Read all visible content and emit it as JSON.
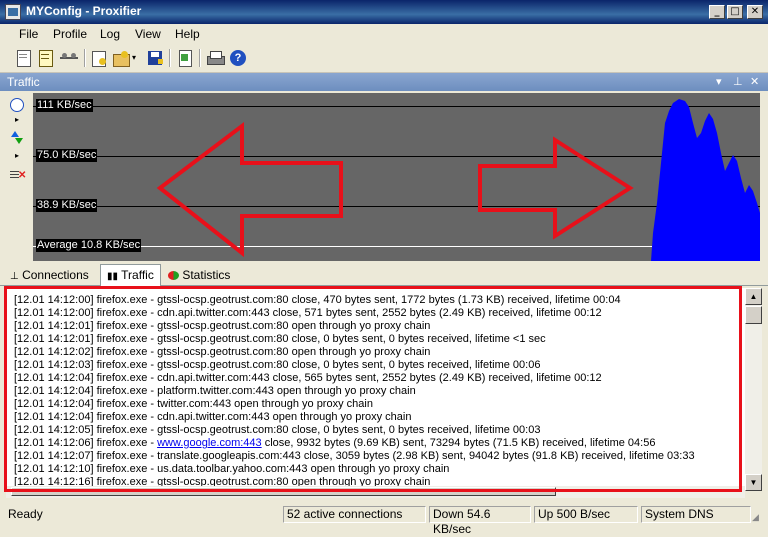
{
  "window": {
    "title": "MYConfig - Proxifier"
  },
  "menu": {
    "items": [
      "File",
      "Profile",
      "Log",
      "View",
      "Help"
    ]
  },
  "toolbar": {
    "icons": [
      "profile-new-icon",
      "profile-edit-icon",
      "network-settings-icon",
      "proxy-add-icon",
      "rules-icon",
      "save-icon",
      "proxy-check-icon",
      "print-icon",
      "help-icon"
    ]
  },
  "panel": {
    "title": "Traffic"
  },
  "graph": {
    "labels": {
      "max": "111 KB/sec",
      "mid": "75.0 KB/sec",
      "low": "38.9 KB/sec",
      "avg": "Average 10.8 KB/sec"
    },
    "fill_color": "#0000ff",
    "background": "#666666"
  },
  "tabs": {
    "connections": "Connections",
    "traffic": "Traffic",
    "statistics": "Statistics"
  },
  "log": {
    "lines": [
      {
        "text": "[12.01 14:12:00] firefox.exe - gtssl-ocsp.geotrust.com:80 close, 470 bytes sent, 1772 bytes (1.73 KB) received, lifetime 00:04"
      },
      {
        "text": "[12.01 14:12:00] firefox.exe - cdn.api.twitter.com:443 close, 571 bytes sent, 2552 bytes (2.49 KB) received, lifetime 00:12"
      },
      {
        "text": "[12.01 14:12:01] firefox.exe - gtssl-ocsp.geotrust.com:80 open through yo proxy chain"
      },
      {
        "text": "[12.01 14:12:01] firefox.exe - gtssl-ocsp.geotrust.com:80 close, 0 bytes sent, 0 bytes received, lifetime <1 sec"
      },
      {
        "text": "[12.01 14:12:02] firefox.exe - gtssl-ocsp.geotrust.com:80 open through yo proxy chain"
      },
      {
        "text": "[12.01 14:12:03] firefox.exe - gtssl-ocsp.geotrust.com:80 close, 0 bytes sent, 0 bytes received, lifetime 00:06"
      },
      {
        "text": "[12.01 14:12:04] firefox.exe - cdn.api.twitter.com:443 close, 565 bytes sent, 2552 bytes (2.49 KB) received, lifetime 00:12"
      },
      {
        "text": "[12.01 14:12:04] firefox.exe - platform.twitter.com:443 open through yo proxy chain"
      },
      {
        "text": "[12.01 14:12:04] firefox.exe - twitter.com:443 open through yo proxy chain"
      },
      {
        "text": "[12.01 14:12:04] firefox.exe - cdn.api.twitter.com:443 open through yo proxy chain"
      },
      {
        "text": "[12.01 14:12:05] firefox.exe - gtssl-ocsp.geotrust.com:80 close, 0 bytes sent, 0 bytes received, lifetime 00:03"
      },
      {
        "prefix": "[12.01 14:12:06] firefox.exe - ",
        "link": "www.google.com:443",
        "suffix": " close, 9932 bytes (9.69 KB) sent, 73294 bytes (71.5 KB) received, lifetime 04:56"
      },
      {
        "text": "[12.01 14:12:07] firefox.exe - translate.googleapis.com:443 close, 3059 bytes (2.98 KB) sent, 94042 bytes (91.8 KB) received, lifetime 03:33"
      },
      {
        "text": "[12.01 14:12:10] firefox.exe - us.data.toolbar.yahoo.com:443 open through yo proxy chain"
      },
      {
        "text": "[12.01 14:12:16] firefox.exe - gtssl-ocsp.geotrust.com:80 open through yo proxy chain"
      }
    ]
  },
  "status": {
    "ready": "Ready",
    "connections": "52 active connections",
    "down": "Down 54.6 KB/sec",
    "up": "Up 500 B/sec",
    "dns": "System DNS"
  },
  "colors": {
    "annotation_red": "#e8101a",
    "title_bar": "#0a246a",
    "panel_header": "#7a99c8"
  }
}
